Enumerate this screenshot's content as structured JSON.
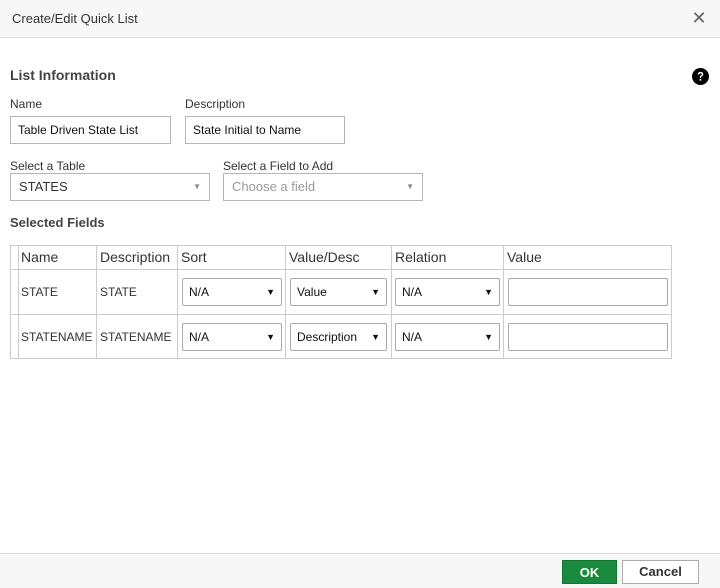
{
  "dialog": {
    "title": "Create/Edit Quick List",
    "close_glyph": "✕"
  },
  "list_info": {
    "heading": "List Information",
    "help_icon": "question-circle-icon",
    "name_label": "Name",
    "name_value": "Table Driven State List",
    "description_label": "Description",
    "description_value": "State Initial to Name",
    "table_label": "Select a Table",
    "table_value": "STATES",
    "field_label": "Select a Field to Add",
    "field_placeholder": "Choose a field"
  },
  "selected_fields": {
    "heading": "Selected Fields",
    "columns": [
      "Name",
      "Description",
      "Sort",
      "Value/Desc",
      "Relation",
      "Value"
    ],
    "rows": [
      {
        "name": "STATE",
        "description": "STATE",
        "sort": "N/A",
        "value_desc": "Value",
        "relation": "N/A",
        "value": ""
      },
      {
        "name": "STATENAME",
        "description": "STATENAME",
        "sort": "N/A",
        "value_desc": "Description",
        "relation": "N/A",
        "value": ""
      }
    ]
  },
  "footer": {
    "ok_label": "OK",
    "cancel_label": "Cancel",
    "ok_color": "#1a8a3e"
  }
}
